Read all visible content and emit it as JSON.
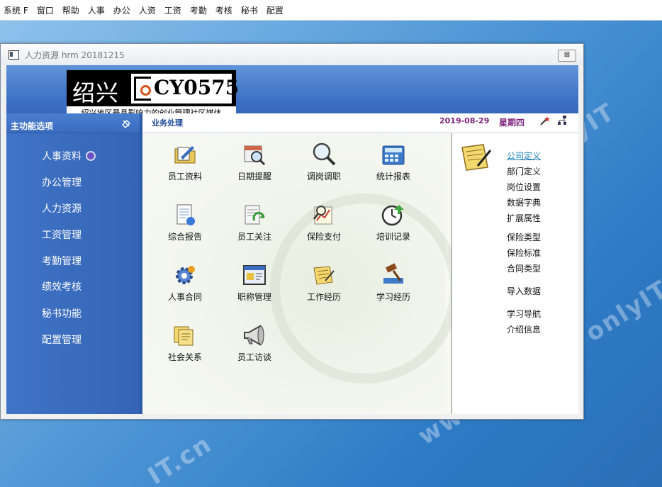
{
  "menu": [
    "系统 F",
    "窗口",
    "帮助",
    "人事",
    "办公",
    "人资",
    "工资",
    "考勤",
    "考核",
    "秘书",
    "配置"
  ],
  "window": {
    "title": "人力资源 hrm 20181215",
    "close_symbol": "⊠"
  },
  "logo": {
    "cn_text": "绍兴",
    "cy_text": "CY0575",
    "slogan": "绍兴地区最具影响力的创业管理社区媒体"
  },
  "sidebar": {
    "title": "主功能选项",
    "items": [
      {
        "label": "人事资料",
        "selected": true
      },
      {
        "label": "办公管理"
      },
      {
        "label": "人力资源"
      },
      {
        "label": "工资管理"
      },
      {
        "label": "考勤管理"
      },
      {
        "label": "绩效考核"
      },
      {
        "label": "秘书功能"
      },
      {
        "label": "配置管理"
      }
    ]
  },
  "main": {
    "title": "业务处理",
    "date": "2019-08-29",
    "weekday": "星期四",
    "tiles": [
      {
        "label": "员工资料",
        "icon": "folder-edit-icon"
      },
      {
        "label": "日期提醒",
        "icon": "calendar-search-icon"
      },
      {
        "label": "调岗调职",
        "icon": "magnifier-icon"
      },
      {
        "label": "统计报表",
        "icon": "calculator-icon"
      },
      {
        "label": "综合报告",
        "icon": "report-icon"
      },
      {
        "label": "员工关注",
        "icon": "document-refresh-icon"
      },
      {
        "label": "保险支付",
        "icon": "chart-magnifier-icon"
      },
      {
        "label": "培训记录",
        "icon": "clock-arrow-icon"
      },
      {
        "label": "人事合同",
        "icon": "gear-icon"
      },
      {
        "label": "职称管理",
        "icon": "window-icon"
      },
      {
        "label": "工作经历",
        "icon": "notes-icon"
      },
      {
        "label": "学习经历",
        "icon": "gavel-icon"
      },
      {
        "label": "社会关系",
        "icon": "folders-icon"
      },
      {
        "label": "员工访谈",
        "icon": "megaphone-icon"
      }
    ]
  },
  "right_links": [
    {
      "label": "公司定义",
      "active": true
    },
    {
      "label": "部门定义"
    },
    {
      "label": "岗位设置"
    },
    {
      "label": "数据字典"
    },
    {
      "label": "扩展属性"
    },
    {
      "label": "保险类型"
    },
    {
      "label": "保险标准"
    },
    {
      "label": "合同类型"
    },
    {
      "label": "导入数据"
    },
    {
      "label": "学习导航"
    },
    {
      "label": "介绍信息"
    }
  ],
  "desktop_watermarks": [
    "onlyIT",
    "onlyIT",
    "www.",
    "IT.cn"
  ]
}
